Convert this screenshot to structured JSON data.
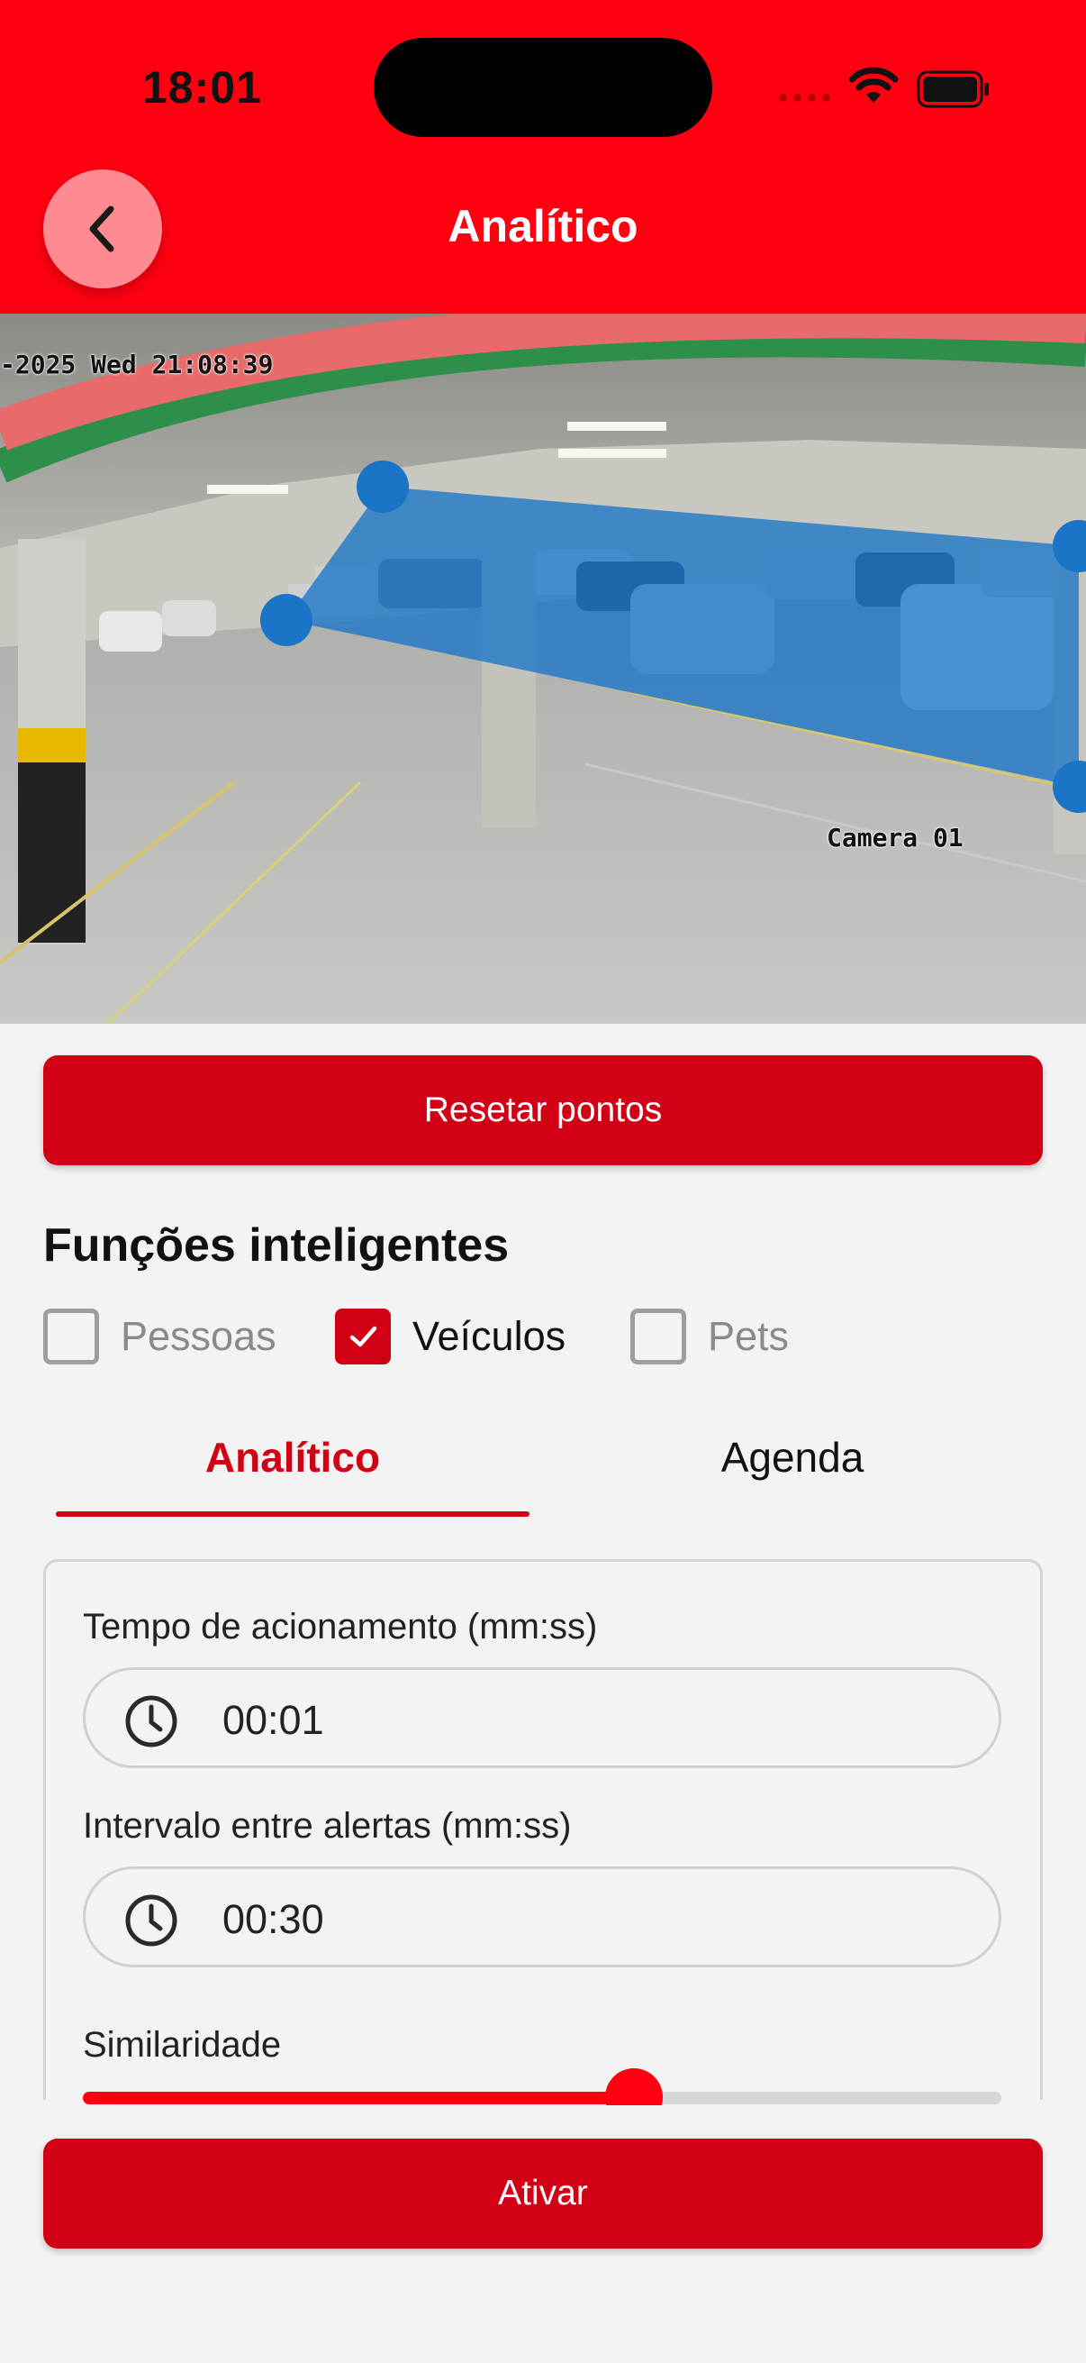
{
  "status_bar": {
    "time": "18:01"
  },
  "header": {
    "title": "Analítico"
  },
  "camera": {
    "timestamp": "-2025 Wed 21:08:39",
    "camera_name": "Camera 01"
  },
  "reset_button": {
    "label": "Resetar pontos"
  },
  "smart_functions": {
    "title": "Funções inteligentes",
    "options": [
      {
        "label": "Pessoas",
        "checked": false
      },
      {
        "label": "Veículos",
        "checked": true
      },
      {
        "label": "Pets",
        "checked": false
      }
    ]
  },
  "tabs": [
    {
      "label": "Analítico",
      "active": true
    },
    {
      "label": "Agenda",
      "active": false
    }
  ],
  "form": {
    "trigger_time": {
      "label": "Tempo de acionamento (mm:ss)",
      "value": "00:01"
    },
    "alert_interval": {
      "label": "Intervalo entre alertas (mm:ss)",
      "value": "00:30"
    },
    "similarity": {
      "label": "Similaridade",
      "value_fraction": 0.6
    }
  },
  "activate_button": {
    "label": "Ativar"
  },
  "colors": {
    "header": "#ff0010",
    "accent": "#d10014",
    "zone": "#1a74c8"
  }
}
